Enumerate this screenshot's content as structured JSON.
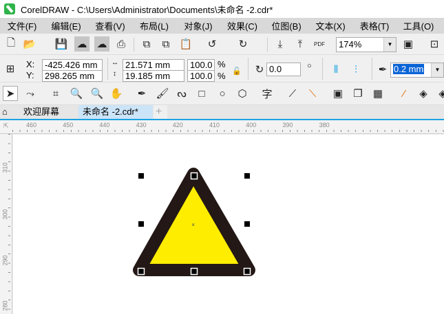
{
  "title": "CorelDRAW - C:\\Users\\Administrator\\Documents\\未命名 -2.cdr*",
  "menu": [
    "文件(F)",
    "编辑(E)",
    "查看(V)",
    "布局(L)",
    "对象(J)",
    "效果(C)",
    "位图(B)",
    "文本(X)",
    "表格(T)",
    "工具(O)"
  ],
  "toolbar": {
    "zoom": "174%",
    "pdf_label": "PDF"
  },
  "property_bar": {
    "x_label": "X:",
    "y_label": "Y:",
    "x": "-425.426 mm",
    "y": "298.265 mm",
    "width": "21.571 mm",
    "height": "19.185 mm",
    "scale_x": "100.0",
    "scale_y": "100.0",
    "percent": "%",
    "rotation": "0.0",
    "outline_width": "0.2 mm"
  },
  "tabs": [
    {
      "label": "欢迎屏幕"
    },
    {
      "label": "未命名 -2.cdr*",
      "active": true
    }
  ],
  "ruler": {
    "h_labels": [
      "460",
      "450",
      "440",
      "430",
      "420",
      "410",
      "400",
      "390",
      "380"
    ],
    "v_labels": [
      "310",
      "300",
      "290",
      "280"
    ]
  },
  "shape": {
    "type": "triangle",
    "fill": "#ffed00",
    "outline": "#231815"
  },
  "colors": {
    "menu_bg": "#d9d9d9",
    "accent": "#1ba1e2",
    "active_tab": "#cce4f7"
  }
}
